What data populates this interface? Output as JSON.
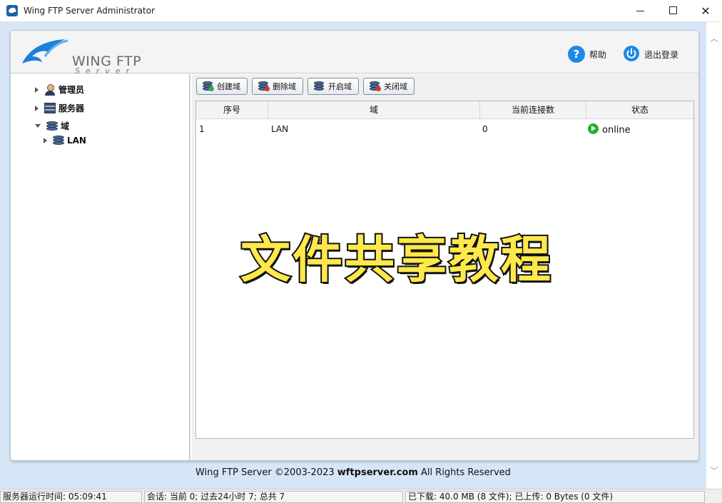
{
  "window": {
    "title": "Wing FTP Server Administrator",
    "minimize": "",
    "maximize": "",
    "close": "✕"
  },
  "header": {
    "logo_text": "WING FTP",
    "logo_sub": "Server",
    "help_label": "帮助",
    "logout_label": "退出登录"
  },
  "tree": {
    "items": [
      {
        "label": "管理员",
        "icon": "admin-user-icon"
      },
      {
        "label": "服务器",
        "icon": "server-icon"
      },
      {
        "label": "域",
        "icon": "domain-icon"
      },
      {
        "label": "LAN",
        "icon": "domain-icon"
      }
    ]
  },
  "toolbar": {
    "create_label": "创建域",
    "delete_label": "删除域",
    "start_label": "开启域",
    "stop_label": "关闭域"
  },
  "table": {
    "columns": [
      "序号",
      "域",
      "当前连接数",
      "状态"
    ],
    "rows": [
      {
        "index": "1",
        "domain": "LAN",
        "connections": "0",
        "status": "online"
      }
    ]
  },
  "overlay": {
    "text": "文件共享教程"
  },
  "footer": {
    "prefix": "Wing FTP Server ©2003-2023 ",
    "site": "wftpserver.com",
    "suffix": " All Rights Reserved"
  },
  "status": {
    "uptime": "服务器运行时间: 05:09:41",
    "sessions": "会话: 当前 0;  过去24小时 7;  总共 7",
    "transfer": "已下载: 40.0 MB (8 文件);  已上传: 0 Bytes (0 文件)"
  },
  "colors": {
    "accent": "#1e88e5",
    "online": "#22b12e",
    "overlay": "#ffe84a"
  }
}
